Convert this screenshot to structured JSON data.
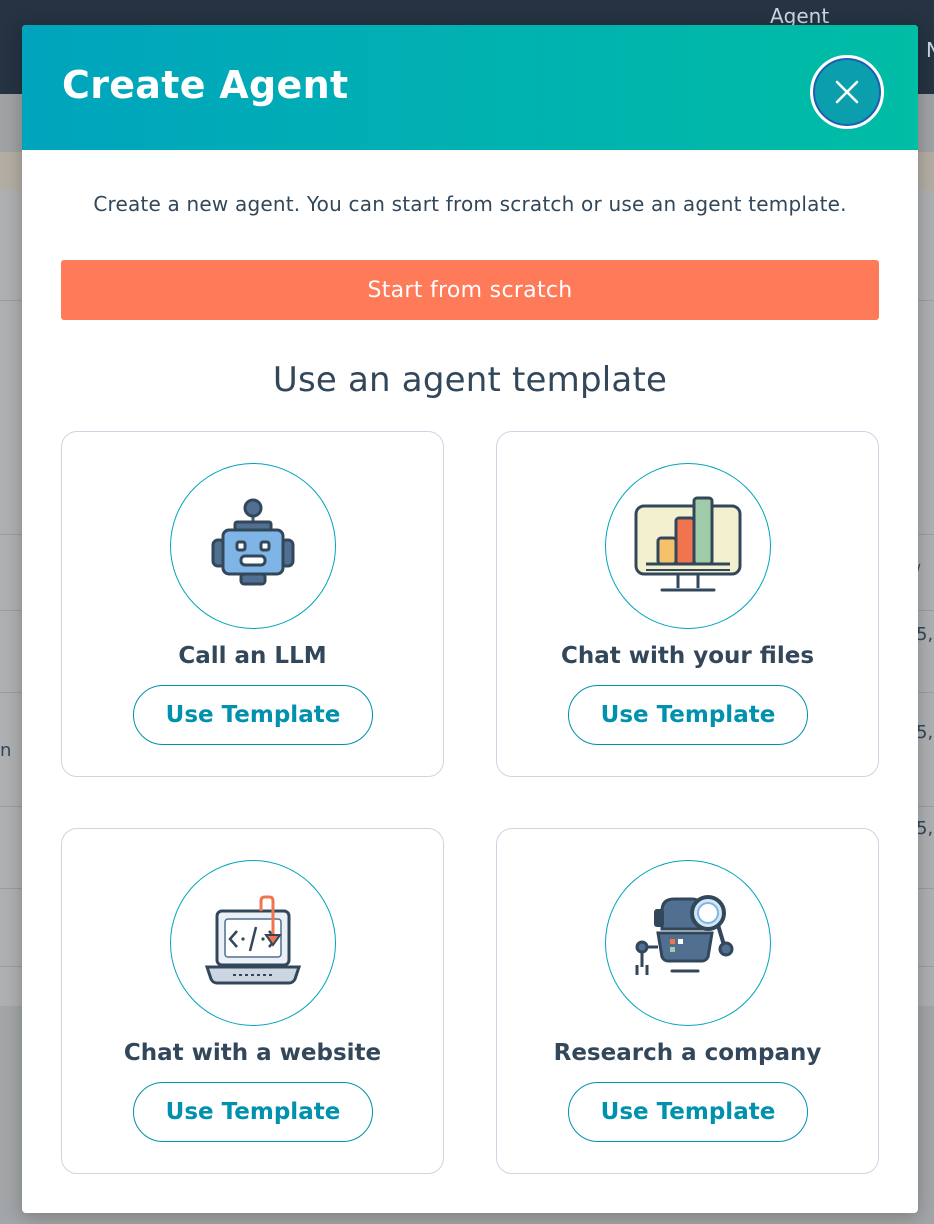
{
  "background": {
    "top_label": "Agent",
    "edge_letter": "N",
    "row_fragments": [
      "5,",
      "5,",
      "5,"
    ],
    "left_fragment": "n",
    "sort_glyph": "∨"
  },
  "modal": {
    "title": "Create Agent",
    "close_icon": "close-icon",
    "intro": "Create a new agent. You can start from scratch or use an agent template.",
    "scratch_label": "Start from scratch",
    "templates_heading": "Use an agent template",
    "templates": [
      {
        "title": "Call an LLM",
        "button": "Use Template",
        "icon": "robot-icon"
      },
      {
        "title": "Chat with your files",
        "button": "Use Template",
        "icon": "chart-monitor-icon"
      },
      {
        "title": "Chat with a website",
        "button": "Use Template",
        "icon": "code-laptop-icon"
      },
      {
        "title": "Research a company",
        "button": "Use Template",
        "icon": "research-robot-icon"
      }
    ]
  },
  "colors": {
    "header_gradient_start": "#00a4bd",
    "header_gradient_end": "#00bda5",
    "primary_button": "#ff7a59",
    "template_button_text": "#0091ae",
    "text": "#33475b"
  }
}
